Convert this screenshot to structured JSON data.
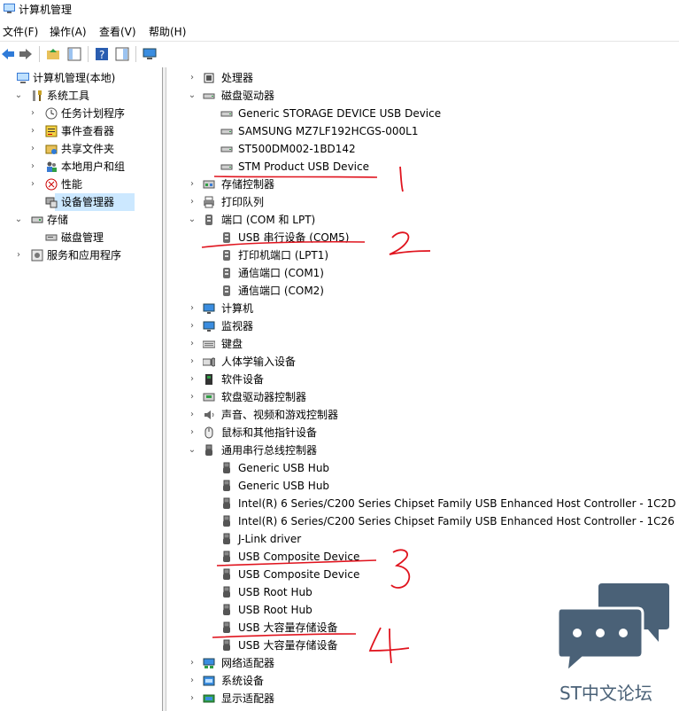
{
  "window": {
    "title": "计算机管理"
  },
  "menu": [
    "文件(F)",
    "操作(A)",
    "查看(V)",
    "帮助(H)"
  ],
  "left_tree": [
    {
      "label": "计算机管理(本地)",
      "indent": 0,
      "arrow": "",
      "icon": "computer-management-icon"
    },
    {
      "label": "系统工具",
      "indent": 1,
      "arrow": "v",
      "icon": "tools-icon"
    },
    {
      "label": "任务计划程序",
      "indent": 2,
      "arrow": ">",
      "icon": "clock-icon"
    },
    {
      "label": "事件查看器",
      "indent": 2,
      "arrow": ">",
      "icon": "event-log-icon"
    },
    {
      "label": "共享文件夹",
      "indent": 2,
      "arrow": ">",
      "icon": "shared-folder-icon"
    },
    {
      "label": "本地用户和组",
      "indent": 2,
      "arrow": ">",
      "icon": "users-icon"
    },
    {
      "label": "性能",
      "indent": 2,
      "arrow": ">",
      "icon": "performance-icon"
    },
    {
      "label": "设备管理器",
      "indent": 2,
      "arrow": "",
      "icon": "device-manager-icon",
      "selected": true
    },
    {
      "label": "存储",
      "indent": 1,
      "arrow": "v",
      "icon": "storage-icon"
    },
    {
      "label": "磁盘管理",
      "indent": 2,
      "arrow": "",
      "icon": "disk-icon"
    },
    {
      "label": "服务和应用程序",
      "indent": 1,
      "arrow": ">",
      "icon": "services-icon"
    }
  ],
  "device_tree": [
    {
      "label": "处理器",
      "level": 0,
      "arrow": ">",
      "icon": "chip-icon"
    },
    {
      "label": "磁盘驱动器",
      "level": 0,
      "arrow": "v",
      "icon": "disk-drive-icon"
    },
    {
      "label": "Generic STORAGE DEVICE USB Device",
      "level": 1,
      "icon": "disk-drive-icon"
    },
    {
      "label": "SAMSUNG MZ7LF192HCGS-000L1",
      "level": 1,
      "icon": "disk-drive-icon"
    },
    {
      "label": "ST500DM002-1BD142",
      "level": 1,
      "icon": "disk-drive-icon"
    },
    {
      "label": "STM Product USB Device",
      "level": 1,
      "icon": "disk-drive-icon"
    },
    {
      "label": "存储控制器",
      "level": 0,
      "arrow": ">",
      "icon": "storage-controller-icon"
    },
    {
      "label": "打印队列",
      "level": 0,
      "arrow": ">",
      "icon": "printer-icon"
    },
    {
      "label": "端口 (COM 和 LPT)",
      "level": 0,
      "arrow": "v",
      "icon": "port-icon"
    },
    {
      "label": "USB 串行设备 (COM5)",
      "level": 1,
      "icon": "port-icon"
    },
    {
      "label": "打印机端口 (LPT1)",
      "level": 1,
      "icon": "port-icon"
    },
    {
      "label": "通信端口 (COM1)",
      "level": 1,
      "icon": "port-icon"
    },
    {
      "label": "通信端口 (COM2)",
      "level": 1,
      "icon": "port-icon"
    },
    {
      "label": "计算机",
      "level": 0,
      "arrow": ">",
      "icon": "monitor-icon"
    },
    {
      "label": "监视器",
      "level": 0,
      "arrow": ">",
      "icon": "monitor-icon"
    },
    {
      "label": "键盘",
      "level": 0,
      "arrow": ">",
      "icon": "keyboard-icon"
    },
    {
      "label": "人体学输入设备",
      "level": 0,
      "arrow": ">",
      "icon": "hid-icon"
    },
    {
      "label": "软件设备",
      "level": 0,
      "arrow": ">",
      "icon": "software-device-icon"
    },
    {
      "label": "软盘驱动器控制器",
      "level": 0,
      "arrow": ">",
      "icon": "floppy-controller-icon"
    },
    {
      "label": "声音、视频和游戏控制器",
      "level": 0,
      "arrow": ">",
      "icon": "speaker-icon"
    },
    {
      "label": "鼠标和其他指针设备",
      "level": 0,
      "arrow": ">",
      "icon": "mouse-icon"
    },
    {
      "label": "通用串行总线控制器",
      "level": 0,
      "arrow": "v",
      "icon": "usb-icon"
    },
    {
      "label": "Generic USB Hub",
      "level": 1,
      "icon": "usb-icon"
    },
    {
      "label": "Generic USB Hub",
      "level": 1,
      "icon": "usb-icon"
    },
    {
      "label": "Intel(R) 6 Series/C200 Series Chipset Family USB Enhanced Host Controller - 1C2D",
      "level": 1,
      "icon": "usb-icon"
    },
    {
      "label": "Intel(R) 6 Series/C200 Series Chipset Family USB Enhanced Host Controller - 1C26",
      "level": 1,
      "icon": "usb-icon"
    },
    {
      "label": "J-Link driver",
      "level": 1,
      "icon": "usb-icon"
    },
    {
      "label": "USB Composite Device",
      "level": 1,
      "icon": "usb-icon"
    },
    {
      "label": "USB Composite Device",
      "level": 1,
      "icon": "usb-icon"
    },
    {
      "label": "USB Root Hub",
      "level": 1,
      "icon": "usb-icon"
    },
    {
      "label": "USB Root Hub",
      "level": 1,
      "icon": "usb-icon"
    },
    {
      "label": "USB 大容量存储设备",
      "level": 1,
      "icon": "usb-icon"
    },
    {
      "label": "USB 大容量存储设备",
      "level": 1,
      "icon": "usb-icon"
    },
    {
      "label": "网络适配器",
      "level": 0,
      "arrow": ">",
      "icon": "network-adapter-icon"
    },
    {
      "label": "系统设备",
      "level": 0,
      "arrow": ">",
      "icon": "system-device-icon"
    },
    {
      "label": "显示适配器",
      "level": 0,
      "arrow": ">",
      "icon": "display-adapter-icon"
    }
  ],
  "annotations": [
    "1",
    "2",
    "3",
    "4"
  ],
  "watermark": {
    "text": "ST中文论坛"
  }
}
